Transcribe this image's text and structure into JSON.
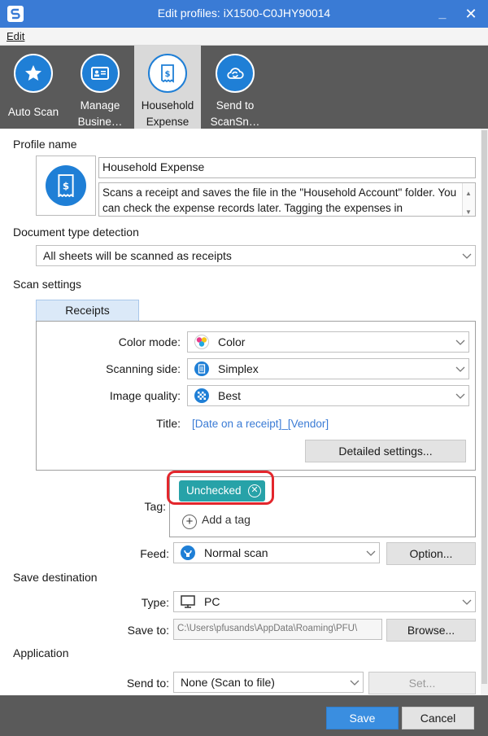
{
  "window": {
    "title": "Edit profiles: iX1500-C0JHY90014",
    "minimize": "_",
    "close": "✕"
  },
  "menu": {
    "edit": "Edit"
  },
  "profile_tabs": [
    {
      "label": "Auto Scan",
      "icon": "star-icon"
    },
    {
      "label": "Manage\nBusine…",
      "icon": "business-card-icon"
    },
    {
      "label": "Household\nExpense",
      "icon": "receipt-icon",
      "active": true
    },
    {
      "label": "Send to\nScanSn…",
      "icon": "cloud-sync-icon"
    }
  ],
  "sections": {
    "profile_name": "Profile name",
    "document_type": "Document type detection",
    "scan_settings": "Scan settings",
    "save_destination": "Save destination",
    "application": "Application"
  },
  "profile": {
    "name": "Household Expense",
    "description": "Scans a receipt and saves the file in the \"Household Account\" folder. You can check the expense records later. Tagging the expenses in"
  },
  "document_type": {
    "selected": "All sheets will be scanned as receipts"
  },
  "scan": {
    "tab": "Receipts",
    "color_mode_label": "Color mode:",
    "color_mode": "Color",
    "side_label": "Scanning side:",
    "side": "Simplex",
    "quality_label": "Image quality:",
    "quality": "Best",
    "title_label": "Title:",
    "title_value": "[Date on a receipt]_[Vendor]",
    "detailed_button": "Detailed settings..."
  },
  "tag": {
    "label": "Tag:",
    "chip": "Unchecked",
    "chip_remove": "⊗",
    "add": "Add a tag"
  },
  "feed": {
    "label": "Feed:",
    "selected": "Normal scan",
    "option_button": "Option..."
  },
  "save": {
    "type_label": "Type:",
    "type": "PC",
    "save_to_label": "Save to:",
    "path": "C:\\Users\\pfusands\\AppData\\Roaming\\PFU\\",
    "browse_button": "Browse..."
  },
  "app": {
    "send_to_label": "Send to:",
    "send_to": "None (Scan to file)",
    "set_button": "Set..."
  },
  "footer": {
    "save": "Save",
    "cancel": "Cancel"
  },
  "colors": {
    "title_bar": "#3a7bd5",
    "accent": "#1f7fd6",
    "tag": "#27a2a8",
    "highlight": "#e3262c"
  }
}
